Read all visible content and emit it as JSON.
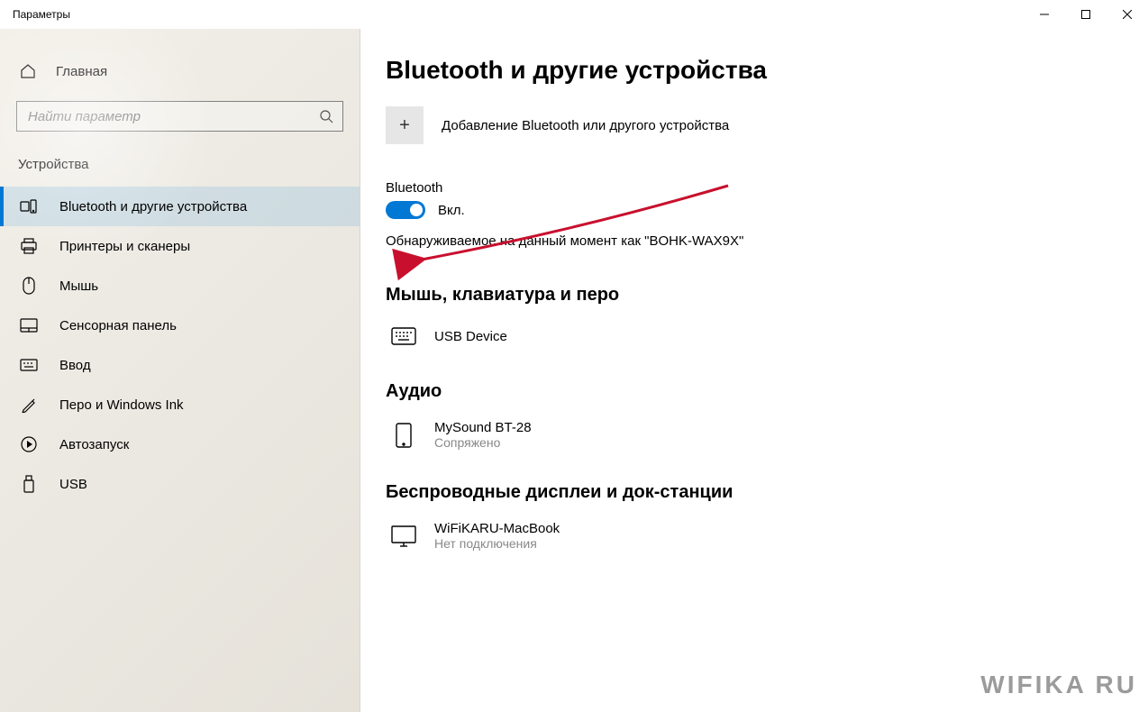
{
  "window": {
    "title": "Параметры"
  },
  "sidebar": {
    "home_label": "Главная",
    "search_placeholder": "Найти параметр",
    "category": "Устройства",
    "items": [
      {
        "label": "Bluetooth и другие устройства",
        "icon": "devices",
        "active": true
      },
      {
        "label": "Принтеры и сканеры",
        "icon": "printer",
        "active": false
      },
      {
        "label": "Мышь",
        "icon": "mouse",
        "active": false
      },
      {
        "label": "Сенсорная панель",
        "icon": "touchpad",
        "active": false
      },
      {
        "label": "Ввод",
        "icon": "keyboard",
        "active": false
      },
      {
        "label": "Перо и Windows Ink",
        "icon": "pen",
        "active": false
      },
      {
        "label": "Автозапуск",
        "icon": "autoplay",
        "active": false
      },
      {
        "label": "USB",
        "icon": "usb",
        "active": false
      }
    ]
  },
  "main": {
    "title": "Bluetooth и другие устройства",
    "add_device_label": "Добавление Bluetooth или другого устройства",
    "bluetooth_label": "Bluetooth",
    "toggle_state_label": "Вкл.",
    "toggle_on": true,
    "discoverable_text": "Обнаруживаемое на данный момент как \"BOHK-WAX9X\"",
    "sections": [
      {
        "header": "Мышь, клавиатура и перо",
        "devices": [
          {
            "name": "USB Device",
            "status": "",
            "icon": "keyboard"
          }
        ]
      },
      {
        "header": "Аудио",
        "devices": [
          {
            "name": "MySound BT-28",
            "status": "Сопряжено",
            "icon": "phone"
          }
        ]
      },
      {
        "header": "Беспроводные дисплеи и док-станции",
        "devices": [
          {
            "name": "WiFiKARU-MacBook",
            "status": "Нет подключения",
            "icon": "monitor"
          }
        ]
      }
    ]
  },
  "watermark": "WIFIKA RU",
  "colors": {
    "accent": "#0078d4",
    "arrow": "#c8102e"
  }
}
